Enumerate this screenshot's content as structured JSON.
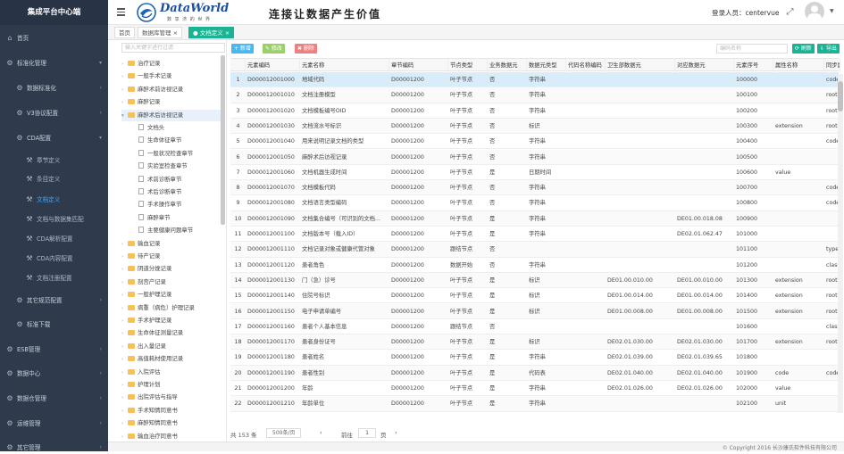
{
  "app": {
    "sidebar_title": "集成平台中心端",
    "logo_text": "DataWorld",
    "logo_sub": "数 享 济 的 世 界",
    "slogan": "连接让数据产生价值",
    "login_label": "登录人员：centervue",
    "accent": "#1ab394"
  },
  "sidebar": {
    "items": [
      {
        "label": "首页",
        "icon": "home-icon",
        "level": 0,
        "chevron": ""
      },
      {
        "label": "标准化管理",
        "icon": "gear-icon",
        "level": 0,
        "chevron": "v"
      },
      {
        "label": "数据标准化",
        "icon": "gear-icon",
        "level": 1,
        "chevron": ">"
      },
      {
        "label": "V3协议配置",
        "icon": "gear-icon",
        "level": 1,
        "chevron": ">"
      },
      {
        "label": "CDA配置",
        "icon": "gear-icon",
        "level": 1,
        "chevron": "v"
      },
      {
        "label": "章节定义",
        "icon": "wrench-icon",
        "level": 2,
        "chevron": ""
      },
      {
        "label": "条目定义",
        "icon": "wrench-icon",
        "level": 2,
        "chevron": ""
      },
      {
        "label": "文档定义",
        "icon": "wrench-icon",
        "level": 2,
        "chevron": "",
        "active": true
      },
      {
        "label": "文档与数据集匹配",
        "icon": "wrench-icon",
        "level": 2,
        "chevron": ""
      },
      {
        "label": "CDA解析配置",
        "icon": "wrench-icon",
        "level": 2,
        "chevron": ""
      },
      {
        "label": "CDA内容配置",
        "icon": "wrench-icon",
        "level": 2,
        "chevron": ""
      },
      {
        "label": "文档注册配置",
        "icon": "wrench-icon",
        "level": 2,
        "chevron": ""
      },
      {
        "label": "其它规范配置",
        "icon": "gear-icon",
        "level": 1,
        "chevron": ">"
      },
      {
        "label": "标准下载",
        "icon": "gear-icon",
        "level": 1,
        "chevron": ""
      },
      {
        "label": "ESB管理",
        "icon": "gear-icon",
        "level": 0,
        "chevron": ">"
      },
      {
        "label": "数据中心",
        "icon": "gear-icon",
        "level": 0,
        "chevron": ">"
      },
      {
        "label": "数据仓管理",
        "icon": "gear-icon",
        "level": 0,
        "chevron": ">"
      },
      {
        "label": "运维管理",
        "icon": "gear-icon",
        "level": 0,
        "chevron": ">"
      },
      {
        "label": "其它管理",
        "icon": "gear-icon",
        "level": 0,
        "chevron": ">"
      }
    ]
  },
  "tabs": [
    {
      "label": "首页",
      "active": false
    },
    {
      "label": "数据库管理 ×",
      "active": false
    },
    {
      "label": "● 文档定义 ×",
      "active": true
    }
  ],
  "tree": {
    "search_placeholder": "输入关键字进行过滤",
    "nodes": [
      {
        "label": "治疗记录",
        "type": "folder",
        "indent": 0,
        "arrow": ">"
      },
      {
        "label": "一般手术记录",
        "type": "folder",
        "indent": 0,
        "arrow": ">"
      },
      {
        "label": "麻醉术前访视记录",
        "type": "folder",
        "indent": 0,
        "arrow": ">"
      },
      {
        "label": "麻醉记录",
        "type": "folder",
        "indent": 0,
        "arrow": ">"
      },
      {
        "label": "麻醉术后访视记录",
        "type": "folder",
        "indent": 0,
        "arrow": "v",
        "selected": true
      },
      {
        "label": "文档头",
        "type": "doc",
        "indent": 1,
        "arrow": ""
      },
      {
        "label": "生命体征章节",
        "type": "doc",
        "indent": 1,
        "arrow": ""
      },
      {
        "label": "一般状况检查章节",
        "type": "doc",
        "indent": 1,
        "arrow": ""
      },
      {
        "label": "实验室检查章节",
        "type": "doc",
        "indent": 1,
        "arrow": ""
      },
      {
        "label": "术前诊断章节",
        "type": "doc",
        "indent": 1,
        "arrow": ""
      },
      {
        "label": "术后诊断章节",
        "type": "doc",
        "indent": 1,
        "arrow": ""
      },
      {
        "label": "手术操作章节",
        "type": "doc",
        "indent": 1,
        "arrow": ""
      },
      {
        "label": "麻醉章节",
        "type": "doc",
        "indent": 1,
        "arrow": ""
      },
      {
        "label": "主要健康问题章节",
        "type": "doc",
        "indent": 1,
        "arrow": ""
      },
      {
        "label": "输血记录",
        "type": "folder",
        "indent": 0,
        "arrow": ">"
      },
      {
        "label": "待产记录",
        "type": "folder",
        "indent": 0,
        "arrow": ">"
      },
      {
        "label": "阴道分娩记录",
        "type": "folder",
        "indent": 0,
        "arrow": ">"
      },
      {
        "label": "剖宫产记录",
        "type": "folder",
        "indent": 0,
        "arrow": ">"
      },
      {
        "label": "一般护理记录",
        "type": "folder",
        "indent": 0,
        "arrow": ">"
      },
      {
        "label": "病重（病危）护理记录",
        "type": "folder",
        "indent": 0,
        "arrow": ">"
      },
      {
        "label": "手术护理记录",
        "type": "folder",
        "indent": 0,
        "arrow": ">"
      },
      {
        "label": "生命体征测量记录",
        "type": "folder",
        "indent": 0,
        "arrow": ">"
      },
      {
        "label": "出入量记录",
        "type": "folder",
        "indent": 0,
        "arrow": ">"
      },
      {
        "label": "高值耗材使用记录",
        "type": "folder",
        "indent": 0,
        "arrow": ">"
      },
      {
        "label": "入院评估",
        "type": "folder",
        "indent": 0,
        "arrow": ">"
      },
      {
        "label": "护理计划",
        "type": "folder",
        "indent": 0,
        "arrow": ">"
      },
      {
        "label": "出院评估与指导",
        "type": "folder",
        "indent": 0,
        "arrow": ">"
      },
      {
        "label": "手术知情同意书",
        "type": "folder",
        "indent": 0,
        "arrow": ">"
      },
      {
        "label": "麻醉知情同意书",
        "type": "folder",
        "indent": 0,
        "arrow": ">"
      },
      {
        "label": "输血治疗同意书",
        "type": "folder",
        "indent": 0,
        "arrow": ">"
      }
    ]
  },
  "toolbar": {
    "add": "+ 新增",
    "edit": "✎ 修改",
    "delete": "✖ 删除",
    "search_placeholder": "编码名称",
    "refresh": "⟳ 刷新",
    "export": "⇩ 导出",
    "add_color": "#4ab8f0",
    "edit_color": "#9ccf6b",
    "delete_color": "#f07f7f",
    "refresh_color": "#1ab394"
  },
  "grid": {
    "columns": [
      "",
      "元素编码",
      "元素名称",
      "章节编码",
      "节点类型",
      "业务数据元",
      "数据元类型",
      "代码名称编码",
      "卫生部数据元",
      "对应数据元",
      "元素序号",
      "属性名称",
      "同步属性"
    ],
    "rows": [
      [
        "1",
        "D000012001000",
        "地域代码",
        "D00001200",
        "叶子节点",
        "否",
        "字符串",
        "",
        "",
        "",
        "100000",
        "",
        "code"
      ],
      [
        "2",
        "D000012001010",
        "文档注册模型",
        "D00001200",
        "叶子节点",
        "否",
        "字符串",
        "",
        "",
        "",
        "100100",
        "",
        "root"
      ],
      [
        "3",
        "D000012001020",
        "文档模板编号OID",
        "D00001200",
        "叶子节点",
        "否",
        "字符串",
        "",
        "",
        "",
        "100200",
        "",
        "root"
      ],
      [
        "4",
        "D000012001030",
        "文档流水号标识",
        "D00001200",
        "叶子节点",
        "否",
        "标识",
        "",
        "",
        "",
        "100300",
        "extension",
        "root"
      ],
      [
        "5",
        "D000012001040",
        "用来说明记录文档的类型",
        "D00001200",
        "叶子节点",
        "否",
        "字符串",
        "",
        "",
        "",
        "100400",
        "",
        "code"
      ],
      [
        "6",
        "D000012001050",
        "麻醉术后访视记录",
        "D00001200",
        "叶子节点",
        "否",
        "字符串",
        "",
        "",
        "",
        "100500",
        "",
        ""
      ],
      [
        "7",
        "D000012001060",
        "文档机器生成时间",
        "D00001200",
        "叶子节点",
        "是",
        "日期时间",
        "",
        "",
        "",
        "100600",
        "value",
        ""
      ],
      [
        "8",
        "D000012001070",
        "文档模板代码",
        "D00001200",
        "叶子节点",
        "否",
        "字符串",
        "",
        "",
        "",
        "100700",
        "",
        "code"
      ],
      [
        "9",
        "D000012001080",
        "文档语言类型编码",
        "D00001200",
        "叶子节点",
        "否",
        "字符串",
        "",
        "",
        "",
        "100800",
        "",
        "code"
      ],
      [
        "10",
        "D000012001090",
        "文档集合编号（可识别的文档...",
        "D00001200",
        "叶子节点",
        "是",
        "字符串",
        "",
        "",
        "DE01.00.018.08",
        "100900",
        "",
        ""
      ],
      [
        "11",
        "D000012001100",
        "文档版本号（载入ID）",
        "D00001200",
        "叶子节点",
        "是",
        "字符串",
        "",
        "",
        "DE02.01.062.47",
        "101000",
        "",
        ""
      ],
      [
        "12",
        "D000012001110",
        "文档记录对象或健康代管对象",
        "D00001200",
        "跟结节点",
        "否",
        "",
        "",
        "",
        "",
        "101100",
        "",
        "type"
      ],
      [
        "13",
        "D000012001120",
        "患者角色",
        "D00001200",
        "数据开始",
        "否",
        "字符串",
        "",
        "",
        "",
        "101200",
        "",
        "class"
      ],
      [
        "14",
        "D000012001130",
        "门（急）诊号",
        "D00001200",
        "叶子节点",
        "是",
        "标识",
        "",
        "DE01.00.010.00",
        "DE01.00.010.00",
        "101300",
        "extension",
        "root"
      ],
      [
        "15",
        "D000012001140",
        "住院号标识",
        "D00001200",
        "叶子节点",
        "是",
        "标识",
        "",
        "DE01.00.014.00",
        "DE01.00.014.00",
        "101400",
        "extension",
        "root"
      ],
      [
        "16",
        "D000012001150",
        "电子申请单编号",
        "D00001200",
        "叶子节点",
        "是",
        "标识",
        "",
        "DE01.00.008.00",
        "DE01.00.008.00",
        "101500",
        "extension",
        "root"
      ],
      [
        "17",
        "D000012001160",
        "患者个人基本信息",
        "D00001200",
        "跟结节点",
        "否",
        "",
        "",
        "",
        "",
        "101600",
        "",
        "class"
      ],
      [
        "18",
        "D000012001170",
        "患者身份证号",
        "D00001200",
        "叶子节点",
        "是",
        "标识",
        "",
        "DE02.01.030.00",
        "DE02.01.030.00",
        "101700",
        "extension",
        "root"
      ],
      [
        "19",
        "D000012001180",
        "患者姓名",
        "D00001200",
        "叶子节点",
        "是",
        "字符串",
        "",
        "DE02.01.039.00",
        "DE02.01.039.65",
        "101800",
        "",
        ""
      ],
      [
        "20",
        "D000012001190",
        "患者性别",
        "D00001200",
        "叶子节点",
        "是",
        "代码表",
        "",
        "DE02.01.040.00",
        "DE02.01.040.00",
        "101900",
        "code",
        "code"
      ],
      [
        "21",
        "D000012001200",
        "年龄",
        "D00001200",
        "叶子节点",
        "是",
        "字符串",
        "",
        "DE02.01.026.00",
        "DE02.01.026.00",
        "102000",
        "value",
        ""
      ],
      [
        "22",
        "D000012001210",
        "年龄单位",
        "D00001200",
        "叶子节点",
        "是",
        "字符串",
        "",
        "",
        "",
        "102100",
        "unit",
        ""
      ]
    ]
  },
  "pager": {
    "total": "共 153 条",
    "page_size": "500条/页",
    "prev": "‹",
    "goto_label": "前往",
    "page": "1",
    "page_suffix": "页",
    "next": "›"
  },
  "footer": {
    "copyright": "© Copyright 2016 长沙康氏软件科技有限公司"
  }
}
